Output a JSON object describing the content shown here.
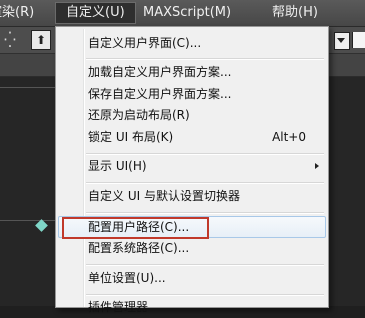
{
  "menubar": {
    "items": [
      {
        "label": "渲染(R)"
      },
      {
        "label": "自定义(U)"
      },
      {
        "label": "MAXScript(M)"
      },
      {
        "label": "帮助(H)"
      }
    ]
  },
  "menu": {
    "customize_ui": "自定义用户界面(C)...",
    "load_scheme": "加载自定义用户界面方案...",
    "save_scheme": "保存自定义用户界面方案...",
    "revert_layout": "还原为启动布局(R)",
    "lock_layout": "锁定 UI 布局(K)",
    "lock_layout_shortcut": "Alt+0",
    "show_ui": "显示 UI(H)",
    "ui_switcher": "自定义 UI 与默认设置切换器",
    "user_paths": "配置用户路径(C)...",
    "system_paths": "配置系统路径(C)...",
    "units_setup": "单位设置(U)...",
    "plugin_manager": "插件管理器"
  },
  "colors": {
    "highlight_box": "#c0392b",
    "menu_bg": "#f0f0f0",
    "menubar_bg": "#4f4f4f"
  }
}
